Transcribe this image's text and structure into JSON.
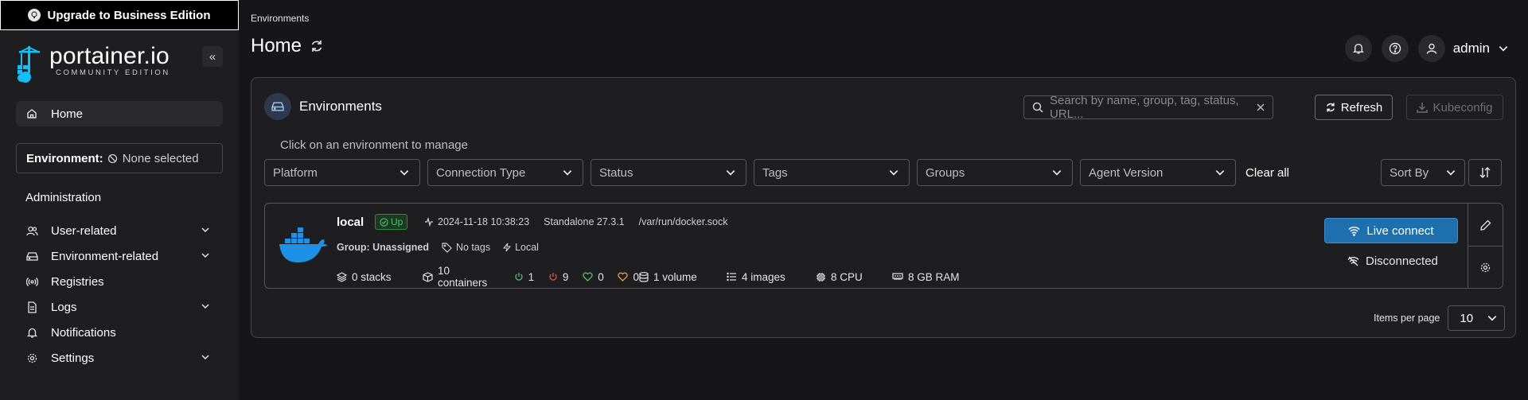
{
  "upgrade_banner": {
    "label": "Upgrade to Business Edition"
  },
  "logo": {
    "main": "portainer.io",
    "sub": "COMMUNITY EDITION"
  },
  "sidebar": {
    "home_label": "Home",
    "environment": {
      "label": "Environment:",
      "value": "None selected"
    },
    "admin_heading": "Administration",
    "items": [
      {
        "label": "User-related",
        "icon": "users-icon",
        "expandable": true
      },
      {
        "label": "Environment-related",
        "icon": "hdd-icon",
        "expandable": true
      },
      {
        "label": "Registries",
        "icon": "radio-icon",
        "expandable": false
      },
      {
        "label": "Logs",
        "icon": "file-icon",
        "expandable": true
      },
      {
        "label": "Notifications",
        "icon": "bell-icon",
        "expandable": false
      },
      {
        "label": "Settings",
        "icon": "gear-icon",
        "expandable": true
      }
    ]
  },
  "header": {
    "breadcrumb": "Environments",
    "title": "Home",
    "user": "admin"
  },
  "panel": {
    "title": "Environments",
    "search_placeholder": "Search by name, group, tag, status, URL...",
    "refresh_label": "Refresh",
    "kubeconfig_label": "Kubeconfig",
    "hint": "Click on an environment to manage",
    "filters": [
      "Platform",
      "Connection Type",
      "Status",
      "Tags",
      "Groups",
      "Agent Version"
    ],
    "clear_all": "Clear all",
    "sort_by": "Sort By"
  },
  "environment_card": {
    "name": "local",
    "status": "Up",
    "timestamp": "2024-11-18 10:38:23",
    "engine": "Standalone 27.3.1",
    "socket": "/var/run/docker.sock",
    "group": "Group: Unassigned",
    "tags": "No tags",
    "type": "Local",
    "stacks": "0 stacks",
    "containers": "10 containers",
    "running": "1",
    "stopped": "9",
    "healthy": "0",
    "unhealthy": "0",
    "volumes": "1 volume",
    "images": "4 images",
    "cpu": "8 CPU",
    "ram": "8 GB RAM",
    "live_connect": "Live connect",
    "connection_state": "Disconnected"
  },
  "pagination": {
    "label": "Items per page",
    "value": "10"
  },
  "colors": {
    "accent": "#1d6fae",
    "up": "#4ec16a",
    "stopped": "#e0514a",
    "unhealthy": "#e8a03a"
  }
}
